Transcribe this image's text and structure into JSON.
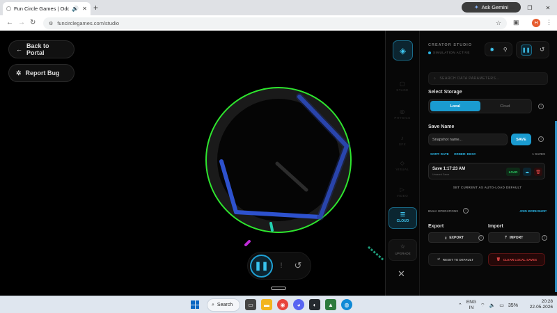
{
  "browser": {
    "tab_title": "Fun Circle Games | Oddly S",
    "new_tab_symbol": "+",
    "gemini_label": "Ask Gemini",
    "url": "funcirclegames.com/studio",
    "avatar_letter": "H",
    "window_controls": [
      "—",
      "❐",
      "✕"
    ]
  },
  "game": {
    "back_label": "Back to Portal",
    "bug_label": "Report Bug",
    "ring_color": "#2ee62e",
    "shape_color": "#3b5fe0"
  },
  "rail": {
    "items": [
      {
        "label": "STAGE",
        "icon": "▢"
      },
      {
        "label": "PHYSICS",
        "icon": "◎"
      },
      {
        "label": "SFX",
        "icon": "♪"
      },
      {
        "label": "VISUAL",
        "icon": "◇"
      },
      {
        "label": "VIDEO",
        "icon": "▷"
      }
    ],
    "cloud_label": "CLOUD",
    "upgrade_label": "UPGRADE"
  },
  "panel": {
    "title": "CREATOR STUDIO",
    "status": "SIMULATION ACTIVE",
    "search_placeholder": "SEARCH DATA PARAMETERS...",
    "select_storage_label": "Select Storage",
    "storage_options": [
      "Local",
      "Cloud"
    ],
    "save_name_label": "Save Name",
    "name_placeholder": "Snapshot name...",
    "save_button": "SAVE",
    "sort_date": "SORT: DATE",
    "order_desc": "ORDER: DESC",
    "count": "1 SAVES",
    "save_item": {
      "title": "Save 1:17:23 AM",
      "subtitle": "Unsaved Game",
      "load": "LOAD"
    },
    "autoload_link": "SET CURRENT AS AUTO-LOAD DEFAULT",
    "bulk_label": "BULK OPERATIONS",
    "join_workshop": "JOIN WORKSHOP",
    "export_label": "Export",
    "import_label": "Import",
    "export_button": "EXPORT",
    "import_button": "IMPORT",
    "reset_default": "RESET TO DEFAULT",
    "clear_saves": "CLEAR LOCAL SAVES"
  },
  "taskbar": {
    "search_label": "Search",
    "lang_top": "ENG",
    "lang_bottom": "IN",
    "battery": "35%",
    "time": "20:28",
    "date": "22-05-2026"
  }
}
